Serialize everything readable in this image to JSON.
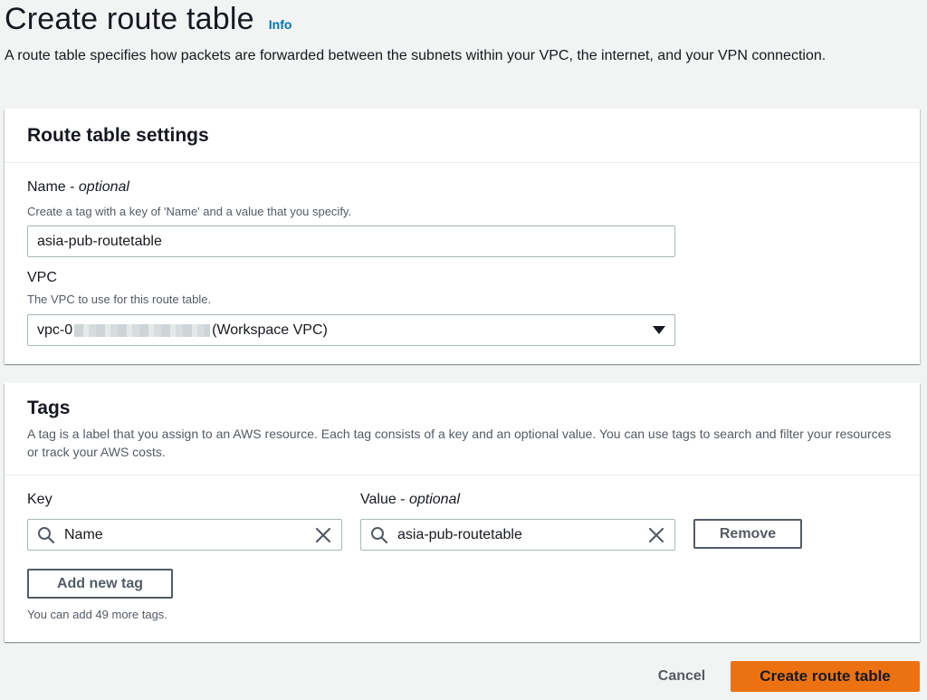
{
  "header": {
    "title": "Create route table",
    "info_label": "Info",
    "description": "A route table specifies how packets are forwarded between the subnets within your VPC, the internet, and your VPN connection."
  },
  "settings": {
    "title": "Route table settings",
    "name": {
      "label": "Name",
      "optional": "optional",
      "hint": "Create a tag with a key of 'Name' and a value that you specify.",
      "value": "asia-pub-routetable"
    },
    "vpc": {
      "label": "VPC",
      "hint": "The VPC to use for this route table.",
      "value_prefix": "vpc-0",
      "value_suffix": "(Workspace VPC)"
    }
  },
  "tags": {
    "title": "Tags",
    "description": "A tag is a label that you assign to an AWS resource. Each tag consists of a key and an optional value. You can use tags to search and filter your resources or track your AWS costs.",
    "key_label": "Key",
    "value_label": "Value",
    "value_optional": "optional",
    "rows": [
      {
        "key": "Name",
        "value": "asia-pub-routetable"
      }
    ],
    "remove_label": "Remove",
    "add_label": "Add new tag",
    "remaining_note": "You can add 49 more tags."
  },
  "footer": {
    "cancel_label": "Cancel",
    "submit_label": "Create route table"
  },
  "colors": {
    "primary_button": "#ec7211",
    "link": "#0073bb",
    "background": "#f2f3f3"
  },
  "icons": {
    "search": "search-icon",
    "clear": "close-icon",
    "dropdown": "caret-down-icon"
  }
}
